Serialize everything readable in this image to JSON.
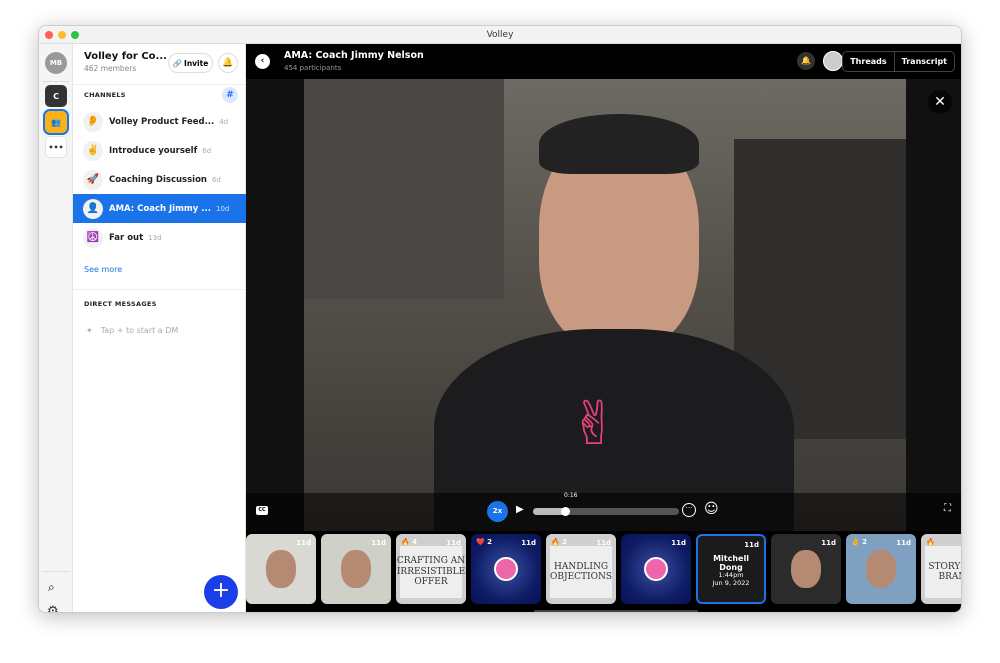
{
  "window": {
    "title": "Volley"
  },
  "rail": {
    "user_initials": "MB",
    "workspace_initial": "C",
    "more": "•••"
  },
  "sidebar": {
    "workspace_name": "Volley for Co...",
    "members": "462 members",
    "invite_label": "Invite",
    "channels_header": "CHANNELS",
    "channels": [
      {
        "icon": "👂",
        "name": "Volley Product Feed...",
        "age": "4d"
      },
      {
        "icon": "✌️",
        "name": "Introduce yourself",
        "age": "6d"
      },
      {
        "icon": "🚀",
        "name": "Coaching Discussion",
        "age": "6d"
      },
      {
        "icon": "👤",
        "name": "AMA: Coach Jimmy ...",
        "age": "10d",
        "selected": true
      },
      {
        "icon": "☮️",
        "name": "Far out",
        "age": "13d"
      }
    ],
    "see_more": "See more",
    "dm_header": "DIRECT MESSAGES",
    "dm_hint": "Tap + to start a DM"
  },
  "header": {
    "title": "AMA: Coach Jimmy Nelson",
    "participants": "454 participants",
    "threads": "Threads",
    "transcript": "Transcript"
  },
  "player": {
    "speed": "2x",
    "time": "0:16",
    "progress": 0.22,
    "cc": "CC"
  },
  "thumbnails": [
    {
      "age": "11d",
      "reaction": "",
      "kind": "face"
    },
    {
      "age": "11d",
      "reaction": "",
      "kind": "face"
    },
    {
      "age": "11d",
      "reaction": "🔥 4",
      "kind": "sign",
      "sign": "CRAFTING AN IRRESISTIBLE OFFER"
    },
    {
      "age": "11d",
      "reaction": "❤️ 2",
      "kind": "rings"
    },
    {
      "age": "11d",
      "reaction": "🔥 2",
      "kind": "sign",
      "sign": "HANDLING OBJECTIONS"
    },
    {
      "age": "11d",
      "reaction": "",
      "kind": "rings"
    },
    {
      "age": "11d",
      "reaction": "",
      "kind": "current",
      "name": "Mitchell Dong",
      "time": "1:44pm",
      "date": "Jun 9, 2022"
    },
    {
      "age": "11d",
      "reaction": "",
      "kind": "face"
    },
    {
      "age": "11d",
      "reaction": "✌️ 2",
      "kind": "face"
    },
    {
      "age": "11d",
      "reaction": "🔥",
      "kind": "sign",
      "sign": "STORY FOR BRAND"
    }
  ],
  "colors": {
    "accent": "#1a73e8",
    "rail_badge": "#f9b115"
  }
}
